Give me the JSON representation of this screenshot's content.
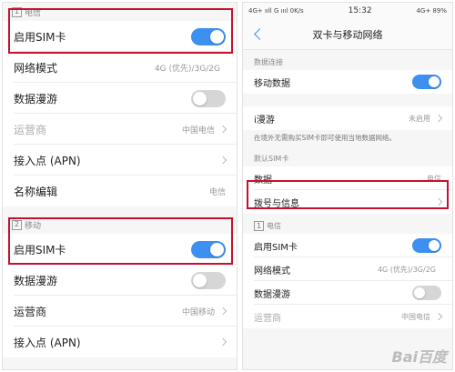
{
  "left": {
    "sim1": {
      "num": "1",
      "title": "电信",
      "enable_label": "启用SIM卡",
      "network_mode_label": "网络模式",
      "network_mode_value": "4G (优先)/3G/2G",
      "roaming_label": "数据漫游",
      "carrier_label": "运营商",
      "carrier_value": "中国电信",
      "apn_label": "接入点 (APN)",
      "name_edit_label": "名称编辑",
      "name_edit_value": "电信"
    },
    "sim2": {
      "num": "2",
      "title": "移动",
      "enable_label": "启用SIM卡",
      "roaming_label": "数据漫游",
      "carrier_label": "运营商",
      "carrier_value": "中国移动",
      "apn_label": "接入点 (APN)"
    }
  },
  "right": {
    "status": {
      "left": "4G+ ııll G ıııl 0K/s",
      "time": "15:32",
      "right": "4G+ 89%"
    },
    "title": "双卡与移动网络",
    "data_conn_header": "数据连接",
    "mobile_data_label": "移动数据",
    "iroam_label": "i漫游",
    "iroam_value": "未启用",
    "iroam_note": "在境外无需购买SIM卡即可使用当地数据网络。",
    "default_sim_header": "默认SIM卡",
    "data_label": "数据",
    "data_value": "电信",
    "dial_label": "拨号与信息",
    "sim1_num": "1",
    "sim1_title": "电信",
    "enable_label": "启用SIM卡",
    "network_mode_label": "网络模式",
    "network_mode_value": "4G (优先)/3G/2G",
    "roaming_label": "数据漫游",
    "carrier_label": "运营商",
    "carrier_value": "中国电信"
  },
  "watermark": "Bai百度"
}
